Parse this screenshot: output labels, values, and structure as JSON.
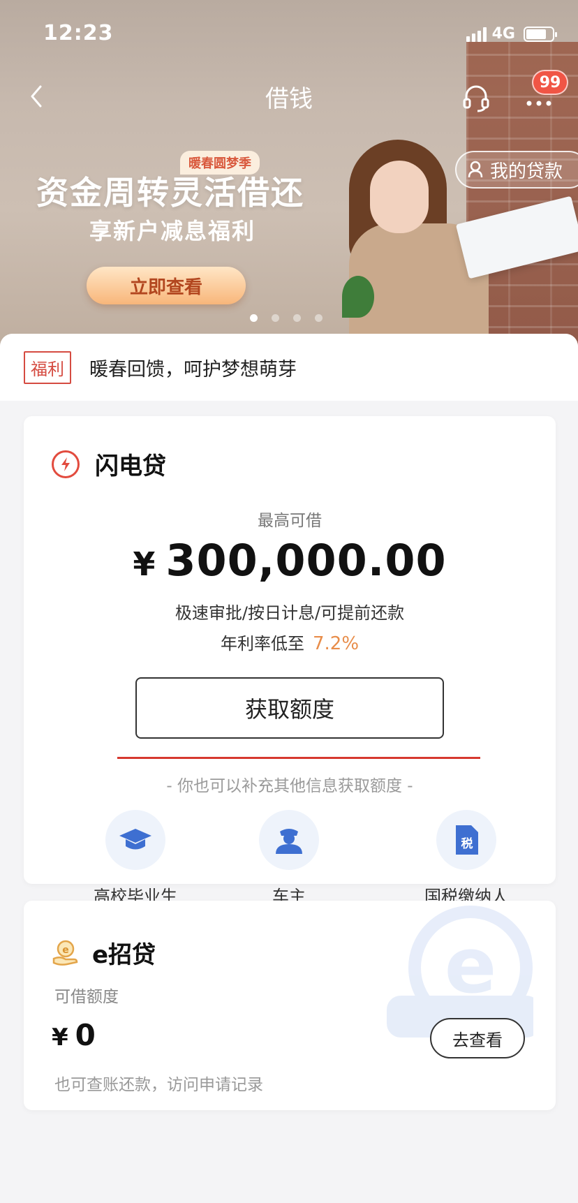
{
  "status_bar": {
    "time": "12:23",
    "network": "4G"
  },
  "nav": {
    "title": "借钱",
    "badge": "99"
  },
  "hero": {
    "my_loans_label": "我的贷款",
    "promo_tag": "暖春圆梦季",
    "promo_title": "资金周转灵活借还",
    "promo_subtitle": "享新户减息福利",
    "promo_button": "立即查看",
    "carousel_count": 4,
    "carousel_active_index": 0
  },
  "welfare": {
    "tag": "福利",
    "text": "暖春回馈，呵护梦想萌芽"
  },
  "flash_loan": {
    "title": "闪电贷",
    "max_label": "最高可借",
    "currency": "¥",
    "amount": "300,000.00",
    "features": "极速审批/按日计息/可提前还款",
    "rate_label": "年利率低至",
    "rate_value": "7.2%",
    "button": "获取额度",
    "hint": "- 你也可以补充其他信息获取额度 -",
    "quick_options": [
      {
        "label": "高校毕业生",
        "icon": "graduation-cap-icon"
      },
      {
        "label": "车主",
        "icon": "driver-icon"
      },
      {
        "label": "国税缴纳人",
        "icon": "tax-document-icon"
      }
    ]
  },
  "e_loan": {
    "title": "e招贷",
    "label": "可借额度",
    "currency": "¥",
    "amount": "0",
    "subtext": "也可查账还款，访问申请记录",
    "button": "去查看"
  },
  "colors": {
    "accent_red": "#d6392f",
    "rate_orange": "#e88d4a",
    "icon_blue": "#3e6fd1",
    "badge_red": "#f05545"
  }
}
